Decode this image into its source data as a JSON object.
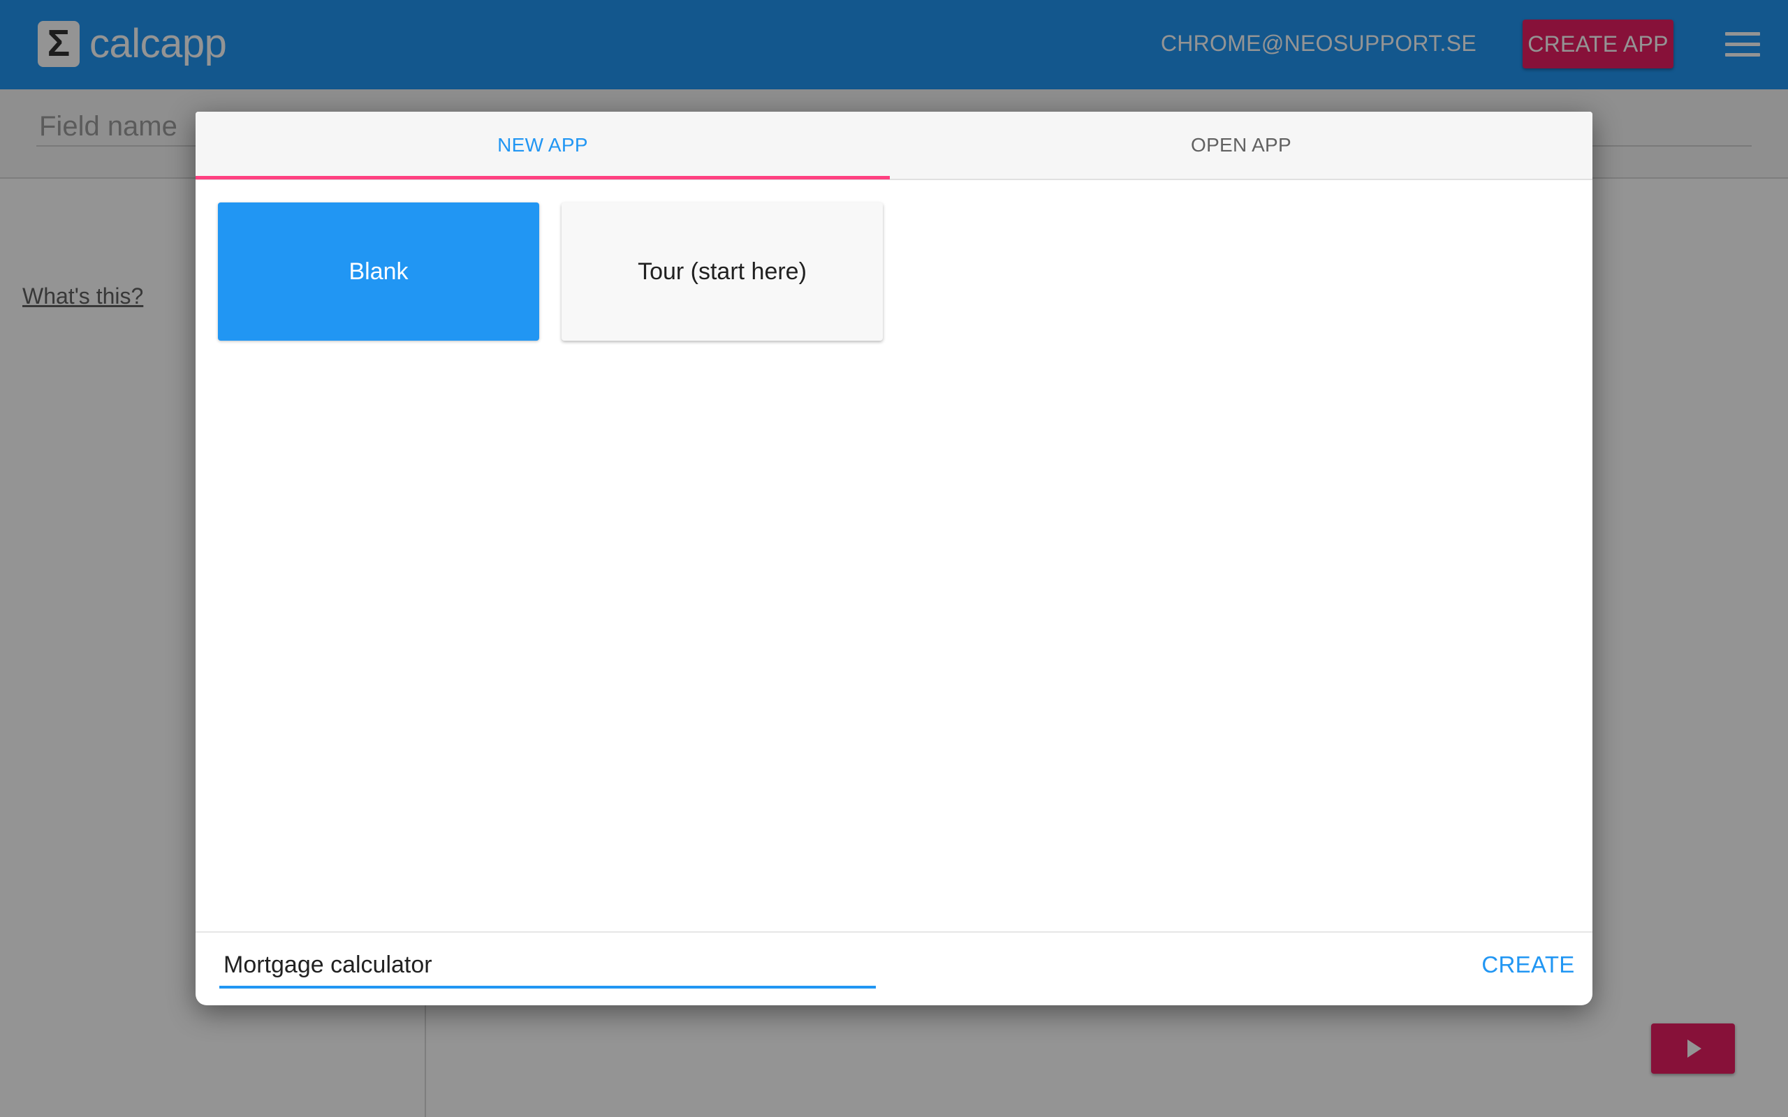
{
  "appbar": {
    "logo_symbol": "Σ",
    "logo_text": "calcapp",
    "user_email": "CHROME@NEOSUPPORT.SE",
    "create_app_label": "CREATE APP",
    "menu_icon": "hamburger-menu-icon"
  },
  "background": {
    "field_name_placeholder": "Field name",
    "whats_this_link": "What's this?",
    "play_icon": "play-icon"
  },
  "dialog": {
    "tabs": [
      {
        "label": "NEW APP",
        "active": true
      },
      {
        "label": "OPEN APP",
        "active": false
      }
    ],
    "templates": [
      {
        "label": "Blank",
        "selected": true
      },
      {
        "label": "Tour (start here)",
        "selected": false
      }
    ],
    "app_name_value": "Mortgage calculator",
    "create_label": "CREATE"
  },
  "colors": {
    "primary": "#2196f3",
    "accent": "#e91e63",
    "tab_indicator": "#ff4081"
  }
}
